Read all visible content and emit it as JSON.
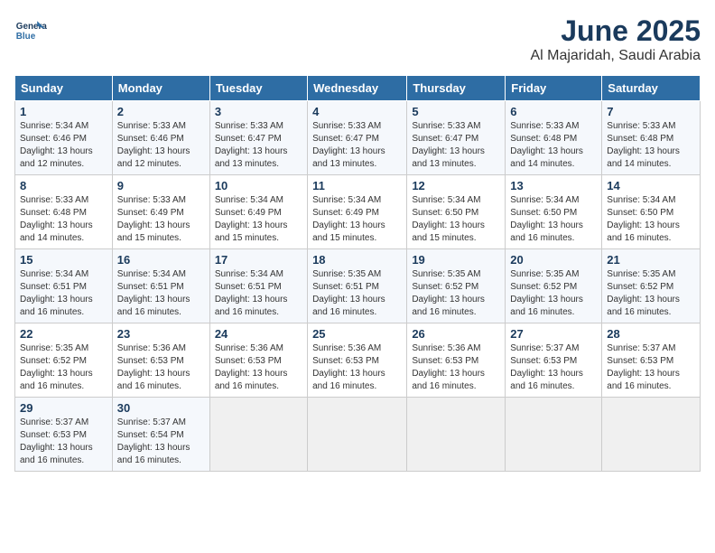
{
  "logo": {
    "line1": "General",
    "line2": "Blue"
  },
  "title": "June 2025",
  "subtitle": "Al Majaridah, Saudi Arabia",
  "weekdays": [
    "Sunday",
    "Monday",
    "Tuesday",
    "Wednesday",
    "Thursday",
    "Friday",
    "Saturday"
  ],
  "weeks": [
    [
      {
        "day": "1",
        "sunrise": "Sunrise: 5:34 AM",
        "sunset": "Sunset: 6:46 PM",
        "daylight": "Daylight: 13 hours and 12 minutes."
      },
      {
        "day": "2",
        "sunrise": "Sunrise: 5:33 AM",
        "sunset": "Sunset: 6:46 PM",
        "daylight": "Daylight: 13 hours and 12 minutes."
      },
      {
        "day": "3",
        "sunrise": "Sunrise: 5:33 AM",
        "sunset": "Sunset: 6:47 PM",
        "daylight": "Daylight: 13 hours and 13 minutes."
      },
      {
        "day": "4",
        "sunrise": "Sunrise: 5:33 AM",
        "sunset": "Sunset: 6:47 PM",
        "daylight": "Daylight: 13 hours and 13 minutes."
      },
      {
        "day": "5",
        "sunrise": "Sunrise: 5:33 AM",
        "sunset": "Sunset: 6:47 PM",
        "daylight": "Daylight: 13 hours and 13 minutes."
      },
      {
        "day": "6",
        "sunrise": "Sunrise: 5:33 AM",
        "sunset": "Sunset: 6:48 PM",
        "daylight": "Daylight: 13 hours and 14 minutes."
      },
      {
        "day": "7",
        "sunrise": "Sunrise: 5:33 AM",
        "sunset": "Sunset: 6:48 PM",
        "daylight": "Daylight: 13 hours and 14 minutes."
      }
    ],
    [
      {
        "day": "8",
        "sunrise": "Sunrise: 5:33 AM",
        "sunset": "Sunset: 6:48 PM",
        "daylight": "Daylight: 13 hours and 14 minutes."
      },
      {
        "day": "9",
        "sunrise": "Sunrise: 5:33 AM",
        "sunset": "Sunset: 6:49 PM",
        "daylight": "Daylight: 13 hours and 15 minutes."
      },
      {
        "day": "10",
        "sunrise": "Sunrise: 5:34 AM",
        "sunset": "Sunset: 6:49 PM",
        "daylight": "Daylight: 13 hours and 15 minutes."
      },
      {
        "day": "11",
        "sunrise": "Sunrise: 5:34 AM",
        "sunset": "Sunset: 6:49 PM",
        "daylight": "Daylight: 13 hours and 15 minutes."
      },
      {
        "day": "12",
        "sunrise": "Sunrise: 5:34 AM",
        "sunset": "Sunset: 6:50 PM",
        "daylight": "Daylight: 13 hours and 15 minutes."
      },
      {
        "day": "13",
        "sunrise": "Sunrise: 5:34 AM",
        "sunset": "Sunset: 6:50 PM",
        "daylight": "Daylight: 13 hours and 16 minutes."
      },
      {
        "day": "14",
        "sunrise": "Sunrise: 5:34 AM",
        "sunset": "Sunset: 6:50 PM",
        "daylight": "Daylight: 13 hours and 16 minutes."
      }
    ],
    [
      {
        "day": "15",
        "sunrise": "Sunrise: 5:34 AM",
        "sunset": "Sunset: 6:51 PM",
        "daylight": "Daylight: 13 hours and 16 minutes."
      },
      {
        "day": "16",
        "sunrise": "Sunrise: 5:34 AM",
        "sunset": "Sunset: 6:51 PM",
        "daylight": "Daylight: 13 hours and 16 minutes."
      },
      {
        "day": "17",
        "sunrise": "Sunrise: 5:34 AM",
        "sunset": "Sunset: 6:51 PM",
        "daylight": "Daylight: 13 hours and 16 minutes."
      },
      {
        "day": "18",
        "sunrise": "Sunrise: 5:35 AM",
        "sunset": "Sunset: 6:51 PM",
        "daylight": "Daylight: 13 hours and 16 minutes."
      },
      {
        "day": "19",
        "sunrise": "Sunrise: 5:35 AM",
        "sunset": "Sunset: 6:52 PM",
        "daylight": "Daylight: 13 hours and 16 minutes."
      },
      {
        "day": "20",
        "sunrise": "Sunrise: 5:35 AM",
        "sunset": "Sunset: 6:52 PM",
        "daylight": "Daylight: 13 hours and 16 minutes."
      },
      {
        "day": "21",
        "sunrise": "Sunrise: 5:35 AM",
        "sunset": "Sunset: 6:52 PM",
        "daylight": "Daylight: 13 hours and 16 minutes."
      }
    ],
    [
      {
        "day": "22",
        "sunrise": "Sunrise: 5:35 AM",
        "sunset": "Sunset: 6:52 PM",
        "daylight": "Daylight: 13 hours and 16 minutes."
      },
      {
        "day": "23",
        "sunrise": "Sunrise: 5:36 AM",
        "sunset": "Sunset: 6:53 PM",
        "daylight": "Daylight: 13 hours and 16 minutes."
      },
      {
        "day": "24",
        "sunrise": "Sunrise: 5:36 AM",
        "sunset": "Sunset: 6:53 PM",
        "daylight": "Daylight: 13 hours and 16 minutes."
      },
      {
        "day": "25",
        "sunrise": "Sunrise: 5:36 AM",
        "sunset": "Sunset: 6:53 PM",
        "daylight": "Daylight: 13 hours and 16 minutes."
      },
      {
        "day": "26",
        "sunrise": "Sunrise: 5:36 AM",
        "sunset": "Sunset: 6:53 PM",
        "daylight": "Daylight: 13 hours and 16 minutes."
      },
      {
        "day": "27",
        "sunrise": "Sunrise: 5:37 AM",
        "sunset": "Sunset: 6:53 PM",
        "daylight": "Daylight: 13 hours and 16 minutes."
      },
      {
        "day": "28",
        "sunrise": "Sunrise: 5:37 AM",
        "sunset": "Sunset: 6:53 PM",
        "daylight": "Daylight: 13 hours and 16 minutes."
      }
    ],
    [
      {
        "day": "29",
        "sunrise": "Sunrise: 5:37 AM",
        "sunset": "Sunset: 6:53 PM",
        "daylight": "Daylight: 13 hours and 16 minutes."
      },
      {
        "day": "30",
        "sunrise": "Sunrise: 5:37 AM",
        "sunset": "Sunset: 6:54 PM",
        "daylight": "Daylight: 13 hours and 16 minutes."
      },
      null,
      null,
      null,
      null,
      null
    ]
  ]
}
